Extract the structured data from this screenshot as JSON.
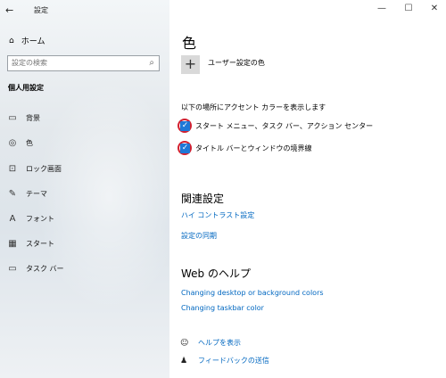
{
  "window": {
    "title": "設定",
    "back_icon": "←",
    "controls": [
      "—",
      "☐",
      "✕"
    ]
  },
  "sidebar": {
    "home_label": "ホーム",
    "search_placeholder": "設定の検索",
    "section_title": "個人用設定",
    "items": [
      {
        "label": "背景",
        "icon": "picture-icon"
      },
      {
        "label": "色",
        "icon": "palette-icon"
      },
      {
        "label": "ロック画面",
        "icon": "lock-screen-icon"
      },
      {
        "label": "テーマ",
        "icon": "theme-icon"
      },
      {
        "label": "フォント",
        "icon": "font-icon"
      },
      {
        "label": "スタート",
        "icon": "start-icon"
      },
      {
        "label": "タスク バー",
        "icon": "taskbar-icon"
      }
    ]
  },
  "main": {
    "title": "色",
    "custom_color_label": "ユーザー設定の色",
    "accent_heading": "以下の場所にアクセント カラーを表示します",
    "checkboxes": [
      {
        "label": "スタート メニュー、タスク バー、アクション センター",
        "checked": true
      },
      {
        "label": "タイトル バーとウィンドウの境界線",
        "checked": true
      }
    ],
    "related_heading": "関連設定",
    "related_links": [
      "ハイ コントラスト設定",
      "設定の同期"
    ],
    "web_help_heading": "Web のヘルプ",
    "web_help_links": [
      "Changing desktop or background colors",
      "Changing taskbar color"
    ],
    "help_links": [
      "ヘルプを表示",
      "フィードバックの送信"
    ]
  },
  "colors": {
    "accent": "#1e78d7",
    "link": "#0067c0",
    "highlight_ring": "#d12030"
  }
}
